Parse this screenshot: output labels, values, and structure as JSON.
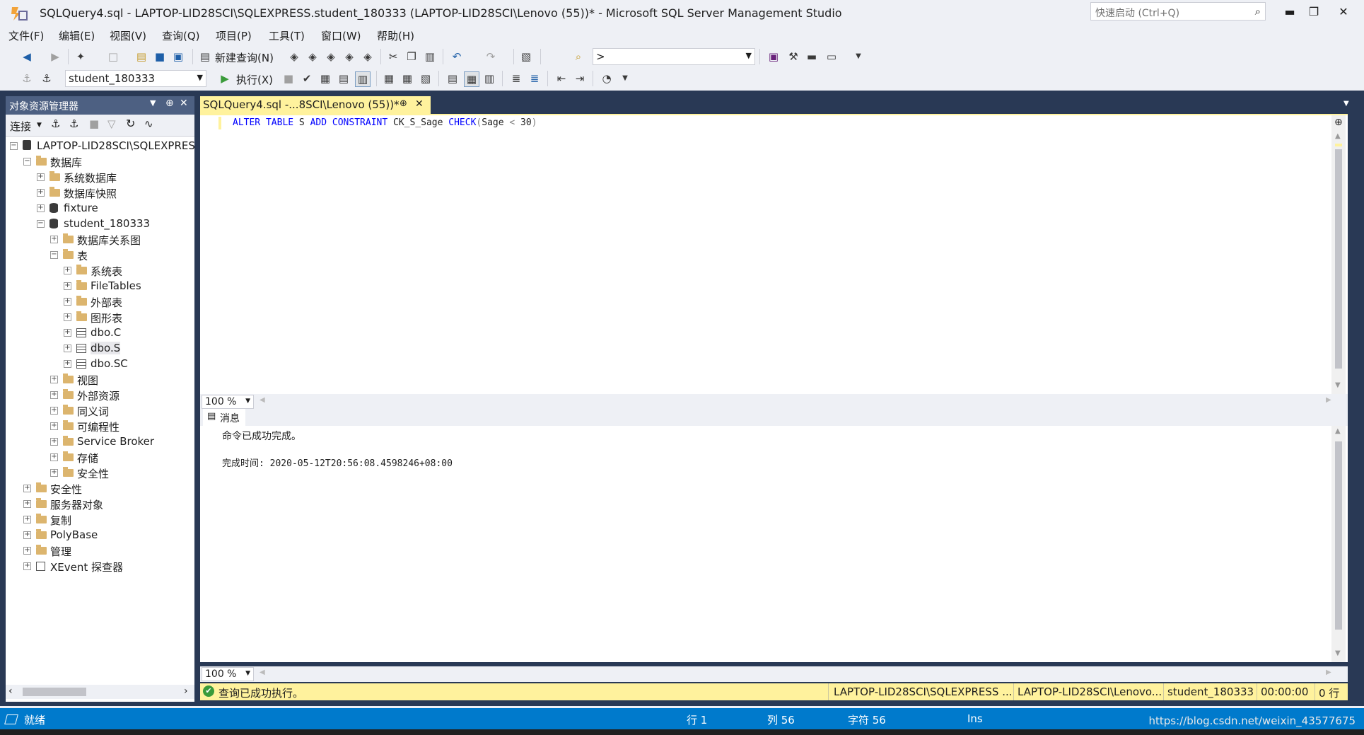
{
  "title_bar": {
    "title": "SQLQuery4.sql - LAPTOP-LID28SCI\\SQLEXPRESS.student_180333 (LAPTOP-LID28SCI\\Lenovo (55))* - Microsoft SQL Server Management Studio",
    "quick_launch_placeholder": "快速启动 (Ctrl+Q)",
    "minimize": "▬",
    "restore": "❐",
    "close": "✕"
  },
  "menu": [
    "文件(F)",
    "编辑(E)",
    "视图(V)",
    "查询(Q)",
    "项目(P)",
    "工具(T)",
    "窗口(W)",
    "帮助(H)"
  ],
  "toolbar1": {
    "new_query": "新建查询(N)",
    "search_combo_value": ">"
  },
  "toolbar2": {
    "database": "student_180333",
    "execute": "执行(X)"
  },
  "object_explorer": {
    "title": "对象资源管理器",
    "connect": "连接",
    "tree": [
      {
        "label": "LAPTOP-LID28SCI\\SQLEXPRESS",
        "level": 0,
        "expander": "−",
        "icon": "server"
      },
      {
        "label": "数据库",
        "level": 1,
        "expander": "−",
        "icon": "folder"
      },
      {
        "label": "系统数据库",
        "level": 2,
        "expander": "+",
        "icon": "folder"
      },
      {
        "label": "数据库快照",
        "level": 2,
        "expander": "+",
        "icon": "folder"
      },
      {
        "label": "fixture",
        "level": 2,
        "expander": "+",
        "icon": "database"
      },
      {
        "label": "student_180333",
        "level": 2,
        "expander": "−",
        "icon": "database"
      },
      {
        "label": "数据库关系图",
        "level": 3,
        "expander": "+",
        "icon": "folder"
      },
      {
        "label": "表",
        "level": 3,
        "expander": "−",
        "icon": "folder"
      },
      {
        "label": "系统表",
        "level": 4,
        "expander": "+",
        "icon": "folder"
      },
      {
        "label": "FileTables",
        "level": 4,
        "expander": "+",
        "icon": "folder"
      },
      {
        "label": "外部表",
        "level": 4,
        "expander": "+",
        "icon": "folder"
      },
      {
        "label": "图形表",
        "level": 4,
        "expander": "+",
        "icon": "folder"
      },
      {
        "label": "dbo.C",
        "level": 4,
        "expander": "+",
        "icon": "table"
      },
      {
        "label": "dbo.S",
        "level": 4,
        "expander": "+",
        "icon": "table",
        "selected": true
      },
      {
        "label": "dbo.SC",
        "level": 4,
        "expander": "+",
        "icon": "table"
      },
      {
        "label": "视图",
        "level": 3,
        "expander": "+",
        "icon": "folder"
      },
      {
        "label": "外部资源",
        "level": 3,
        "expander": "+",
        "icon": "folder"
      },
      {
        "label": "同义词",
        "level": 3,
        "expander": "+",
        "icon": "folder"
      },
      {
        "label": "可编程性",
        "level": 3,
        "expander": "+",
        "icon": "folder"
      },
      {
        "label": "Service Broker",
        "level": 3,
        "expander": "+",
        "icon": "folder"
      },
      {
        "label": "存储",
        "level": 3,
        "expander": "+",
        "icon": "folder"
      },
      {
        "label": "安全性",
        "level": 3,
        "expander": "+",
        "icon": "folder"
      },
      {
        "label": "安全性",
        "level": 1,
        "expander": "+",
        "icon": "folder"
      },
      {
        "label": "服务器对象",
        "level": 1,
        "expander": "+",
        "icon": "folder"
      },
      {
        "label": "复制",
        "level": 1,
        "expander": "+",
        "icon": "folder"
      },
      {
        "label": "PolyBase",
        "level": 1,
        "expander": "+",
        "icon": "folder"
      },
      {
        "label": "管理",
        "level": 1,
        "expander": "+",
        "icon": "folder"
      },
      {
        "label": "XEvent 探查器",
        "level": 1,
        "expander": "+",
        "icon": "xevent"
      }
    ]
  },
  "editor": {
    "tab_title": "SQLQuery4.sql -...8SCI\\Lenovo (55))*",
    "pin": "⊕",
    "close": "✕",
    "code_tokens": [
      {
        "t": "ALTER",
        "k": "kw"
      },
      {
        "t": " ",
        "k": ""
      },
      {
        "t": "TABLE",
        "k": "kw"
      },
      {
        "t": " S ",
        "k": ""
      },
      {
        "t": "ADD",
        "k": "kw"
      },
      {
        "t": " ",
        "k": ""
      },
      {
        "t": "CONSTRAINT",
        "k": "kw"
      },
      {
        "t": " CK_S_Sage ",
        "k": ""
      },
      {
        "t": "CHECK",
        "k": "kw"
      },
      {
        "t": "(",
        "k": "op"
      },
      {
        "t": "Sage ",
        "k": ""
      },
      {
        "t": "<",
        "k": "op"
      },
      {
        "t": " 30",
        "k": ""
      },
      {
        "t": ")",
        "k": "op"
      }
    ],
    "zoom": "100 %"
  },
  "results": {
    "tab": "消息",
    "line1": "命令已成功完成。",
    "line2": "完成时间: 2020-05-12T20:56:08.4598246+08:00",
    "zoom": "100 %"
  },
  "query_status": {
    "message": "查询已成功执行。",
    "server": "LAPTOP-LID28SCI\\SQLEXPRESS ...",
    "login": "LAPTOP-LID28SCI\\Lenovo...",
    "database": "student_180333",
    "elapsed": "00:00:00",
    "rows": "0 行"
  },
  "statusbar": {
    "ready": "就绪",
    "line": "行 1",
    "col": "列 56",
    "char": "字符 56",
    "ins": "Ins",
    "watermark": "https://blog.csdn.net/weixin_43577675"
  },
  "colors": {
    "accent": "#007acc",
    "tab_active": "#fff29d",
    "dark_bg": "#293955",
    "keyword": "#0000ff"
  }
}
